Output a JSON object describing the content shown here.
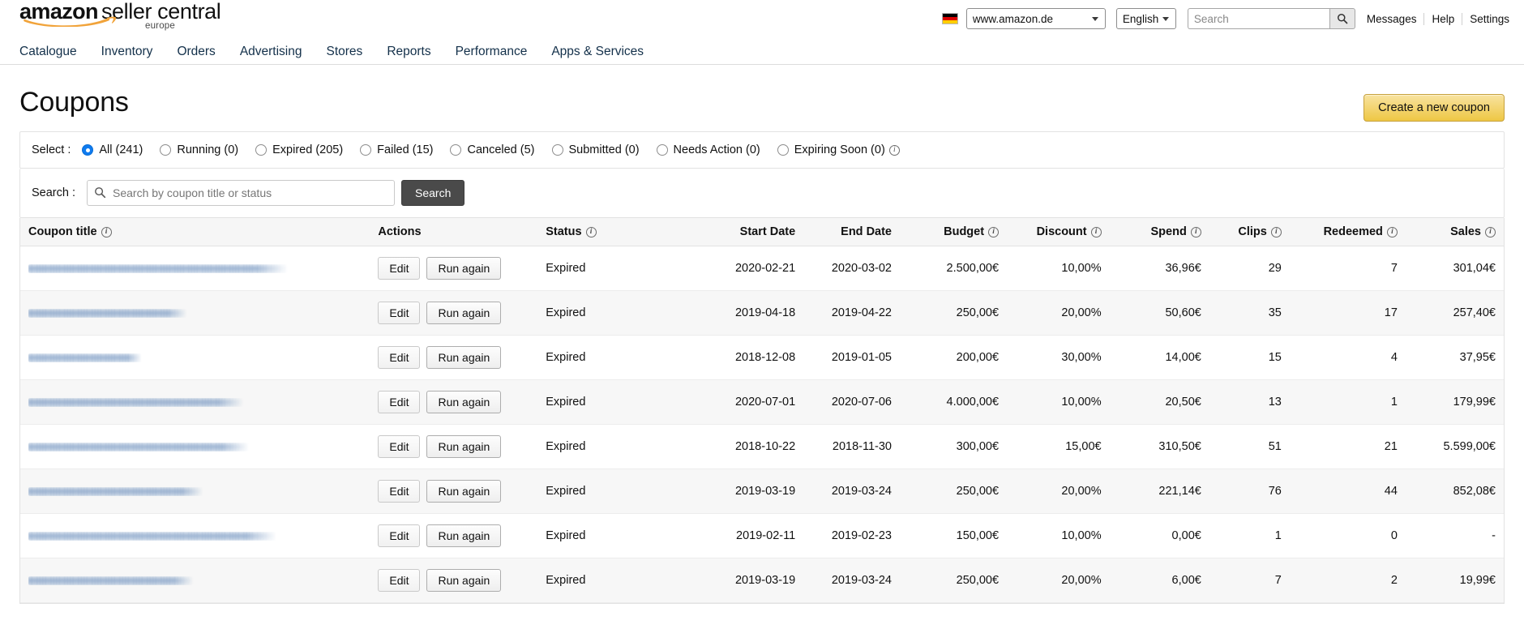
{
  "header": {
    "logo": {
      "brand": "amazon",
      "product": "seller central",
      "region": "europe",
      "swoosh_color": "#f1a33a"
    },
    "flag_icon": "german-flag-icon",
    "marketplace": {
      "value": "www.amazon.de",
      "options": [
        "www.amazon.de"
      ]
    },
    "language": {
      "value": "English",
      "options": [
        "English"
      ]
    },
    "search": {
      "value": "",
      "placeholder": "Search",
      "button_icon": "search-icon"
    },
    "links": [
      {
        "label": "Messages"
      },
      {
        "label": "Help"
      },
      {
        "label": "Settings"
      }
    ]
  },
  "nav": {
    "items": [
      {
        "label": "Catalogue"
      },
      {
        "label": "Inventory"
      },
      {
        "label": "Orders"
      },
      {
        "label": "Advertising"
      },
      {
        "label": "Stores"
      },
      {
        "label": "Reports"
      },
      {
        "label": "Performance"
      },
      {
        "label": "Apps & Services"
      }
    ]
  },
  "page": {
    "title": "Coupons",
    "create_button": "Create a new coupon",
    "accent_color": "#eec744"
  },
  "filters": {
    "label": "Select :",
    "options": [
      {
        "label": "All (241)",
        "checked": true
      },
      {
        "label": "Running (0)",
        "checked": false
      },
      {
        "label": "Expired (205)",
        "checked": false
      },
      {
        "label": "Failed (15)",
        "checked": false
      },
      {
        "label": "Canceled (5)",
        "checked": false
      },
      {
        "label": "Submitted (0)",
        "checked": false
      },
      {
        "label": "Needs Action (0)",
        "checked": false
      },
      {
        "label": "Expiring Soon (0)",
        "checked": false,
        "info": true
      }
    ]
  },
  "search_panel": {
    "label": "Search :",
    "input_value": "",
    "input_placeholder": "Search by coupon title or status",
    "button_label": "Search"
  },
  "table": {
    "columns": [
      {
        "label": "Coupon title",
        "info": true,
        "align": "left"
      },
      {
        "label": "Actions",
        "info": false,
        "align": "left"
      },
      {
        "label": "Status",
        "info": true,
        "align": "left"
      },
      {
        "label": "Start Date",
        "info": false,
        "align": "right"
      },
      {
        "label": "End Date",
        "info": false,
        "align": "right"
      },
      {
        "label": "Budget",
        "info": true,
        "align": "right"
      },
      {
        "label": "Discount",
        "info": true,
        "align": "right"
      },
      {
        "label": "Spend",
        "info": true,
        "align": "right"
      },
      {
        "label": "Clips",
        "info": true,
        "align": "right"
      },
      {
        "label": "Redeemed",
        "info": true,
        "align": "right"
      },
      {
        "label": "Sales",
        "info": true,
        "align": "right"
      }
    ],
    "row_actions": {
      "edit": "Edit",
      "run_again": "Run again"
    },
    "rows": [
      {
        "title": "",
        "title_redacted_width": 320,
        "status": "Expired",
        "start": "2020-02-21",
        "end": "2020-03-02",
        "budget": "2.500,00€",
        "discount": "10,00%",
        "spend": "36,96€",
        "clips": "29",
        "redeemed": "7",
        "sales": "301,04€"
      },
      {
        "title": "",
        "title_redacted_width": 196,
        "status": "Expired",
        "start": "2019-04-18",
        "end": "2019-04-22",
        "budget": "250,00€",
        "discount": "20,00%",
        "spend": "50,60€",
        "clips": "35",
        "redeemed": "17",
        "sales": "257,40€"
      },
      {
        "title": "",
        "title_redacted_width": 140,
        "status": "Expired",
        "start": "2018-12-08",
        "end": "2019-01-05",
        "budget": "200,00€",
        "discount": "30,00%",
        "spend": "14,00€",
        "clips": "15",
        "redeemed": "4",
        "sales": "37,95€"
      },
      {
        "title": "",
        "title_redacted_width": 266,
        "status": "Expired",
        "start": "2020-07-01",
        "end": "2020-07-06",
        "budget": "4.000,00€",
        "discount": "10,00%",
        "spend": "20,50€",
        "clips": "13",
        "redeemed": "1",
        "sales": "179,99€"
      },
      {
        "title": "",
        "title_redacted_width": 272,
        "status": "Expired",
        "start": "2018-10-22",
        "end": "2018-11-30",
        "budget": "300,00€",
        "discount": "15,00€",
        "spend": "310,50€",
        "clips": "51",
        "redeemed": "21",
        "sales": "5.599,00€"
      },
      {
        "title": "",
        "title_redacted_width": 216,
        "status": "Expired",
        "start": "2019-03-19",
        "end": "2019-03-24",
        "budget": "250,00€",
        "discount": "20,00%",
        "spend": "221,14€",
        "clips": "76",
        "redeemed": "44",
        "sales": "852,08€"
      },
      {
        "title": "",
        "title_redacted_width": 306,
        "status": "Expired",
        "start": "2019-02-11",
        "end": "2019-02-23",
        "budget": "150,00€",
        "discount": "10,00%",
        "spend": "0,00€",
        "clips": "1",
        "redeemed": "0",
        "sales": "-"
      },
      {
        "title": "",
        "title_redacted_width": 204,
        "status": "Expired",
        "start": "2019-03-19",
        "end": "2019-03-24",
        "budget": "250,00€",
        "discount": "20,00%",
        "spend": "6,00€",
        "clips": "7",
        "redeemed": "2",
        "sales": "19,99€"
      }
    ]
  }
}
